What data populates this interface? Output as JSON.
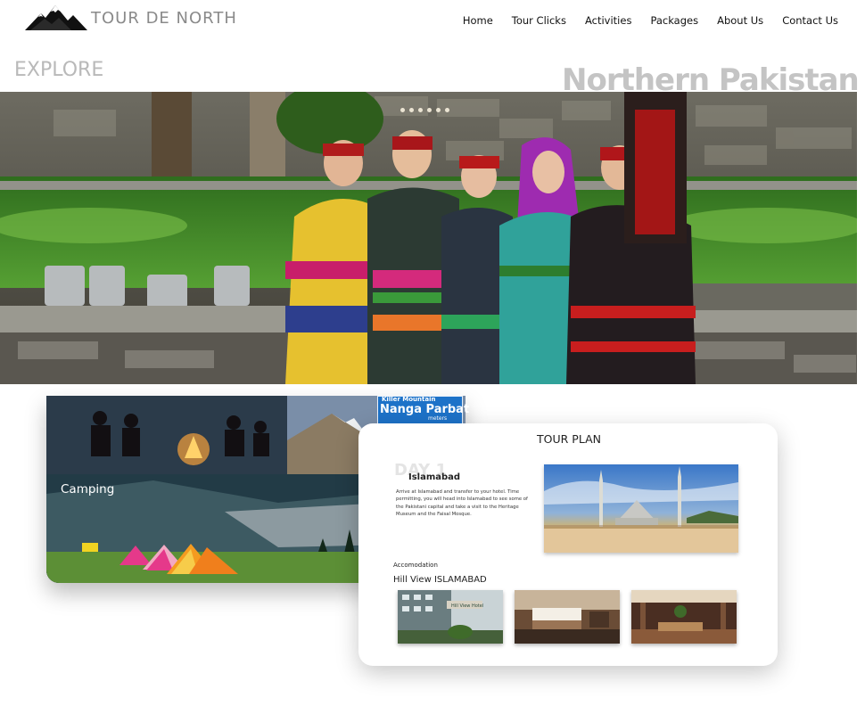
{
  "header": {
    "logo_text": "TOUR DE NORTH",
    "logo_icon": "mountain-icon",
    "nav": [
      "Home",
      "Tour Clicks",
      "Activities",
      "Packages",
      "About Us",
      "Contact Us"
    ]
  },
  "hero": {
    "explore_label": "EXPLORE",
    "region_title": "Northern Pakistan",
    "carousel_dot_count": 6
  },
  "camping": {
    "label": "Camping",
    "sign_top": "Killer Mountain",
    "sign_main": "Nanga Parbat",
    "sign_foot": "meters"
  },
  "tour_plan": {
    "title": "TOUR PLAN",
    "day": "DAY 1",
    "city": "Islamabad",
    "description": "Arrive at Islamabad and transfer to your hotel. Time permitting, you will head into Islamabad to see some of the Pakistani capital and take a visit to the Heritage Museum and the Faisal Mosque.",
    "accommodation_label": "Accomodation",
    "hotel_name": "Hill View ISLAMABAD",
    "hotel_sign": "Hill View Hotel"
  },
  "colors": {
    "accent_text": "#8a8a8a",
    "sign_blue": "#1d72c8",
    "tent_pink": "#e5398a",
    "tent_orange": "#f59b20"
  }
}
